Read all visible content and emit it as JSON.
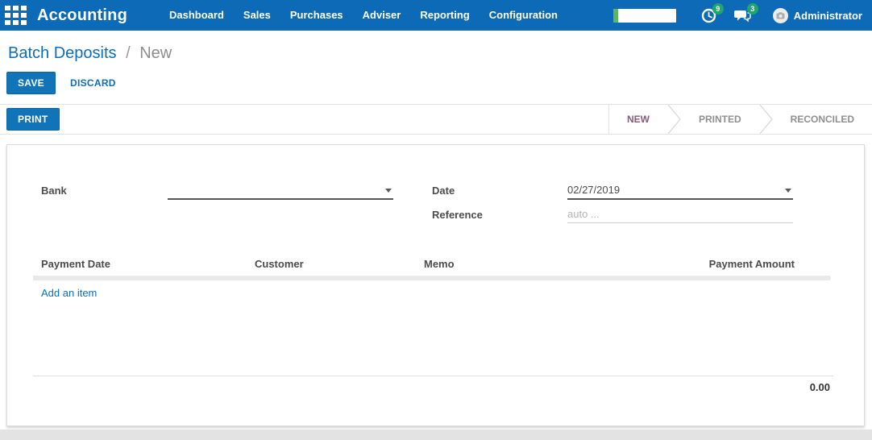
{
  "topbar": {
    "brand": "Accounting",
    "nav_items": [
      "Dashboard",
      "Sales",
      "Purchases",
      "Adviser",
      "Reporting",
      "Configuration"
    ],
    "progress": {
      "percent": 8
    },
    "activity_badge": "9",
    "messages_badge": "3",
    "user": "Administrator"
  },
  "breadcrumb": {
    "parent": "Batch Deposits",
    "separator": "/",
    "current": "New"
  },
  "actions": {
    "save": "SAVE",
    "discard": "DISCARD",
    "print": "PRINT"
  },
  "statusbar": {
    "states": [
      {
        "label": "NEW",
        "active": true
      },
      {
        "label": "PRINTED",
        "active": false
      },
      {
        "label": "RECONCILED",
        "active": false
      }
    ]
  },
  "form": {
    "bank_label": "Bank",
    "bank_value": "",
    "date_label": "Date",
    "date_value": "02/27/2019",
    "reference_label": "Reference",
    "reference_placeholder": "auto ..."
  },
  "lines_table": {
    "headers": [
      "Payment Date",
      "Customer",
      "Memo",
      "Payment Amount"
    ],
    "add_item_label": "Add an item",
    "rows": [],
    "total": "0.00"
  },
  "colors": {
    "navbar_blue": "#0c6ab6",
    "primary_blue": "#0e6db8",
    "state_active_purple": "#875a7b",
    "badge_green": "#1fa56d",
    "progress_green": "#5cb85c"
  }
}
